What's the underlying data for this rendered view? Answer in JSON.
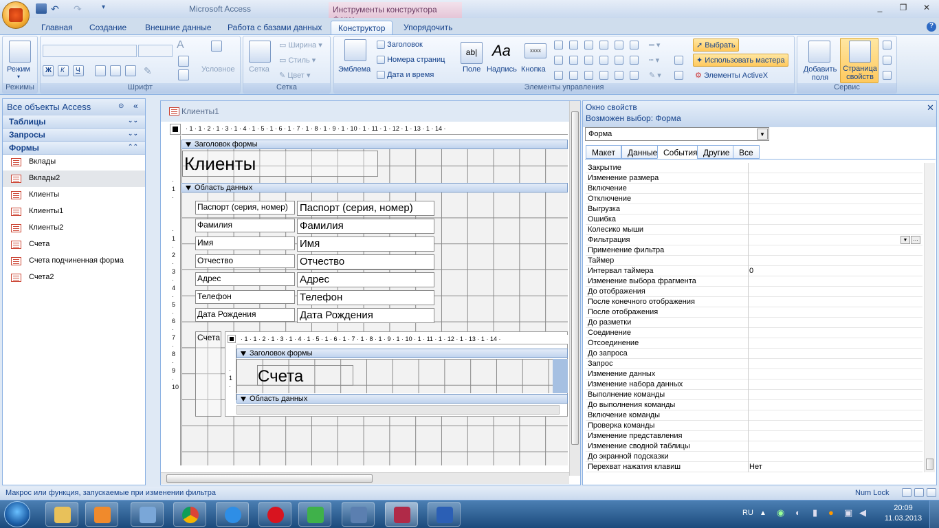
{
  "window": {
    "app_title": "Microsoft Access",
    "context_title": "Инструменты конструктора форм"
  },
  "tabs": [
    {
      "label": "Главная"
    },
    {
      "label": "Создание"
    },
    {
      "label": "Внешние данные"
    },
    {
      "label": "Работа с базами данных"
    },
    {
      "label": "Конструктор"
    },
    {
      "label": "Упорядочить"
    }
  ],
  "ribbon": {
    "groups": {
      "modes": "Режимы",
      "font": "Шрифт",
      "grid": "Сетка",
      "controls": "Элементы управления",
      "tools": "Сервис"
    },
    "mode_label": "Режим",
    "conditional_label": "Условное",
    "grid_button": "Сетка",
    "width_label": "Ширина",
    "style_label": "Стиль",
    "color_label": "Цвет",
    "logo_label": "Эмблема",
    "header_label": "Заголовок",
    "pagenum_label": "Номера страниц",
    "datetime_label": "Дата и время",
    "field_label": "Поле",
    "caption_label": "Надпись",
    "button_label": "Кнопка",
    "select_label": "Выбрать",
    "wizard_label": "Использовать мастера",
    "activex_label": "Элементы ActiveX",
    "addfields_label": "Добавить поля",
    "propsheet_label": "Страница свойств",
    "bold": "Ж",
    "italic": "К",
    "underline": "Ч",
    "font_sample": "A"
  },
  "nav": {
    "title": "Все объекты Access",
    "groups": [
      {
        "label": "Таблицы"
      },
      {
        "label": "Запросы"
      },
      {
        "label": "Формы"
      }
    ],
    "items": [
      {
        "label": "Вклады"
      },
      {
        "label": "Вклады2"
      },
      {
        "label": "Клиенты"
      },
      {
        "label": "Клиенты1"
      },
      {
        "label": "Клиенты2"
      },
      {
        "label": "Счета"
      },
      {
        "label": "Счета подчиненная форма"
      },
      {
        "label": "Счета2"
      }
    ]
  },
  "doc": {
    "tab_title": "Клиенты1",
    "header_section": "Заголовок формы",
    "data_section": "Область данных",
    "form_title": "Клиенты",
    "fields": [
      {
        "label": "Паспорт (серия, номер)",
        "value": "Паспорт (серия, номер)"
      },
      {
        "label": "Фамилия",
        "value": "Фамилия"
      },
      {
        "label": "Имя",
        "value": "Имя"
      },
      {
        "label": "Отчество",
        "value": "Отчество"
      },
      {
        "label": "Адрес",
        "value": "Адрес"
      },
      {
        "label": "Телефон",
        "value": "Телефон"
      },
      {
        "label": "Дата Рождения",
        "value": "Дата Рождения"
      }
    ],
    "subform_label": "Счета",
    "subform_header": "Заголовок формы",
    "subform_title": "Счета",
    "subform_data": "Область данных",
    "ruler": "· 1 · 1 · 2 · 1 · 3 · 1 · 4 · 1 · 5 · 1 · 6 · 1 · 7 · 1 · 8 · 1 · 9 · 1 · 10 · 1 · 11 · 1 · 12 · 1 · 13 · 1 · 14 ·"
  },
  "props": {
    "title": "Окно свойств",
    "selection": "Возможен выбор:  Форма",
    "object": "Форма",
    "tabs": [
      {
        "label": "Макет"
      },
      {
        "label": "Данные"
      },
      {
        "label": "События"
      },
      {
        "label": "Другие"
      },
      {
        "label": "Все"
      }
    ],
    "rows": [
      {
        "name": "Закрытие",
        "value": ""
      },
      {
        "name": "Изменение размера",
        "value": ""
      },
      {
        "name": "Включение",
        "value": ""
      },
      {
        "name": "Отключение",
        "value": ""
      },
      {
        "name": "Выгрузка",
        "value": ""
      },
      {
        "name": "Ошибка",
        "value": ""
      },
      {
        "name": "Колесико мыши",
        "value": ""
      },
      {
        "name": "Фильтрация",
        "value": ""
      },
      {
        "name": "Применение фильтра",
        "value": ""
      },
      {
        "name": "Таймер",
        "value": ""
      },
      {
        "name": "Интервал таймера",
        "value": "0"
      },
      {
        "name": "Изменение выбора фрагмента",
        "value": ""
      },
      {
        "name": "До отображения",
        "value": ""
      },
      {
        "name": "После конечного отображения",
        "value": ""
      },
      {
        "name": "После отображения",
        "value": ""
      },
      {
        "name": "До разметки",
        "value": ""
      },
      {
        "name": "Соединение",
        "value": ""
      },
      {
        "name": "Отсоединение",
        "value": ""
      },
      {
        "name": "До запроса",
        "value": ""
      },
      {
        "name": "Запрос",
        "value": ""
      },
      {
        "name": "Изменение данных",
        "value": ""
      },
      {
        "name": "Изменение набора данных",
        "value": ""
      },
      {
        "name": "Выполнение команды",
        "value": ""
      },
      {
        "name": "До выполнения команды",
        "value": ""
      },
      {
        "name": "Включение команды",
        "value": ""
      },
      {
        "name": "Проверка команды",
        "value": ""
      },
      {
        "name": "Изменение представления",
        "value": ""
      },
      {
        "name": "Изменение сводной таблицы",
        "value": ""
      },
      {
        "name": "До экранной подсказки",
        "value": ""
      },
      {
        "name": "Перехват нажатия клавиш",
        "value": "Нет"
      }
    ]
  },
  "status": {
    "text": "Макрос или функция, запускаемые при изменении фильтра",
    "numlock": "Num Lock"
  },
  "taskbar": {
    "lang": "RU",
    "time": "20:09",
    "date": "11.03.2013"
  }
}
